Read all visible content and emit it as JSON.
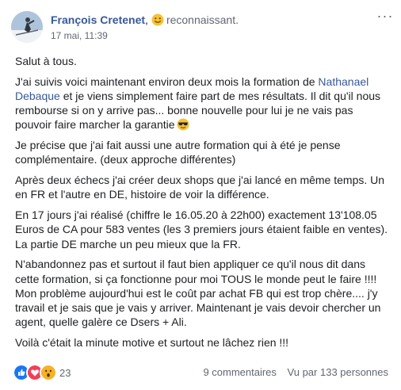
{
  "post": {
    "author": "François Cretenet",
    "author_suffix": ",",
    "feeling": "reconnaissant.",
    "timestamp": "17 mai, 11:39",
    "options_label": "···",
    "icons": {
      "avatar": "profile-photo",
      "feeling": "smiling-face-icon",
      "p1_emoji": "sunglasses-face-icon",
      "options": "more-options-icon"
    },
    "paragraphs": {
      "p0": "Salut à tous.",
      "p1_before": "J'ai suivis voici maintenant environ deux mois la formation de ",
      "p1_link": "Nathanael Debaque",
      "p1_after": " et je viens simplement faire part de mes résultats. Il dit qu'il nous rembourse si on y arrive pas... bonne nouvelle pour lui je ne vais pas pouvoir faire marcher la garantie",
      "p2": "Je précise que j'ai fait aussi une autre formation qui à été je pense complémentaire. (deux approche différentes)",
      "p3": "Après deux échecs j'ai créer deux shops que j'ai lancé en même temps. Un en FR et l'autre en DE, histoire de voir la différence.",
      "p4": "En 17 jours j'ai réalisé (chiffre le 16.05.20 à 22h00) exactement 13'108.05 Euros de CA pour 583 ventes (les 3 premiers jours étaient faible en ventes). La partie DE marche un peu mieux que la FR.",
      "p5": "N'abandonnez pas et surtout il faut bien appliquer ce qu'il nous dit dans cette formation, si ça fonctionne pour moi TOUS le monde peut le faire !!!! Mon problème aujourd'hui est le coût par achat FB qui est trop chère.... j'y travail et je sais que je vais y arriver. Maintenant je vais devoir chercher un agent, quelle galère ce Dsers + Ali.",
      "p6": "Voilà c'était la minute motive et surtout ne lâchez rien !!!"
    },
    "reactions": {
      "count": "23",
      "types": [
        "like",
        "love",
        "wow"
      ],
      "colors": {
        "like": "#1877f2",
        "love": "#f33e58",
        "wow": "#f7b125"
      }
    },
    "stats": {
      "comments": "9 commentaires",
      "views": "Vu par 133 personnes"
    }
  }
}
